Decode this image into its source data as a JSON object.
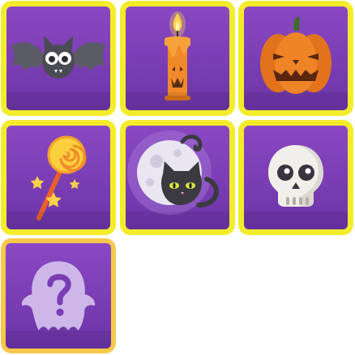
{
  "colors": {
    "frame": "#f3ec2b",
    "frame_locked": "#f6c84c",
    "tile_background": "#7b3fb6"
  },
  "tiles": [
    {
      "icon": "bat-icon",
      "state": "unlocked"
    },
    {
      "icon": "candle-icon",
      "state": "unlocked"
    },
    {
      "icon": "pumpkin-icon",
      "state": "unlocked"
    },
    {
      "icon": "lollipop-icon",
      "state": "unlocked"
    },
    {
      "icon": "black-cat-moon-icon",
      "state": "unlocked"
    },
    {
      "icon": "skull-icon",
      "state": "unlocked"
    },
    {
      "icon": "ghost-question-icon",
      "state": "locked"
    }
  ]
}
